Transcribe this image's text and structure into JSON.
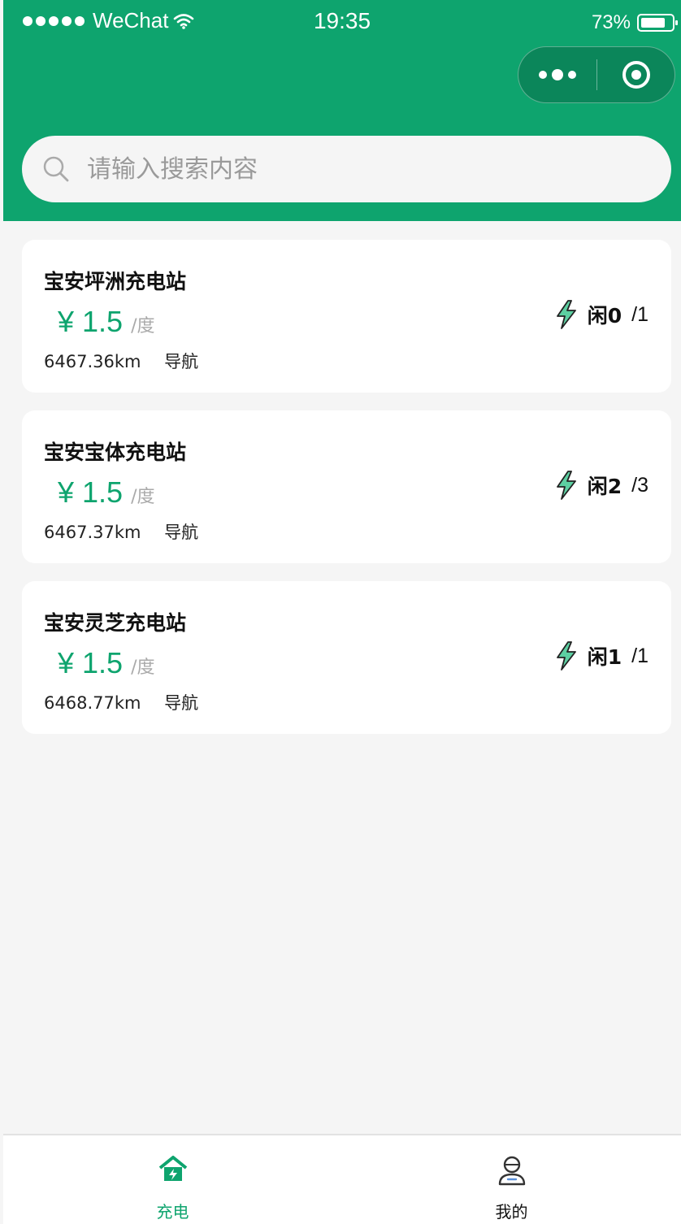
{
  "status_bar": {
    "carrier": "WeChat",
    "time": "19:35",
    "battery": "73%",
    "battery_level": 0.73
  },
  "capsule": {
    "more_icon": "more-dots-icon",
    "close_icon": "target-close-icon"
  },
  "search": {
    "placeholder": "请输入搜索内容",
    "value": ""
  },
  "stations": [
    {
      "name": "宝安坪洲充电站",
      "price": "¥ 1.5",
      "unit": "/度",
      "distance": "6467.36km",
      "nav": "导航",
      "idle": "闲0",
      "total": "/1"
    },
    {
      "name": "宝安宝体充电站",
      "price": "¥ 1.5",
      "unit": "/度",
      "distance": "6467.37km",
      "nav": "导航",
      "idle": "闲2",
      "total": "/3"
    },
    {
      "name": "宝安灵芝充电站",
      "price": "¥ 1.5",
      "unit": "/度",
      "distance": "6468.77km",
      "nav": "导航",
      "idle": "闲1",
      "total": "/1"
    }
  ],
  "tabbar": {
    "items": [
      {
        "label": "充电",
        "icon": "charging-home-icon",
        "active": true
      },
      {
        "label": "我的",
        "icon": "user-profile-icon",
        "active": false
      }
    ]
  },
  "colors": {
    "brand": "#0ea46e",
    "background": "#f5f5f5"
  }
}
